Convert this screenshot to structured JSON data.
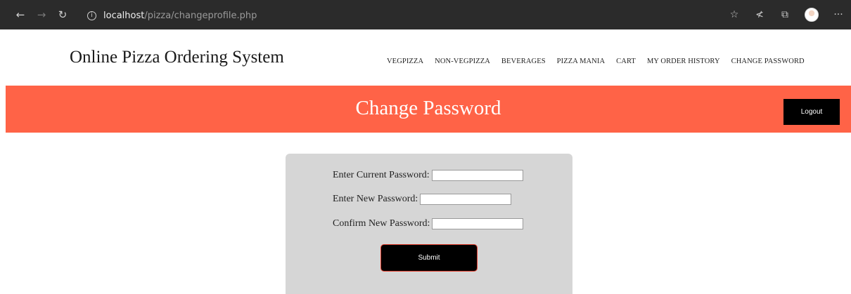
{
  "browser": {
    "url_host": "localhost",
    "url_path": "/pizza/changeprofile.php",
    "icons": [
      "back-arrow-icon",
      "forward-arrow-icon",
      "refresh-icon",
      "info-icon",
      "favorite-star-icon",
      "favorites-list-icon",
      "collections-icon",
      "profile-avatar",
      "more-icon"
    ]
  },
  "site": {
    "title": "Online Pizza Ordering System"
  },
  "menu": {
    "items": [
      {
        "label": "VEGPIZZA"
      },
      {
        "label": "NON-VEGPIZZA"
      },
      {
        "label": "BEVERAGES"
      },
      {
        "label": "PIZZA MANIA"
      },
      {
        "label": "CART"
      },
      {
        "label": "MY ORDER HISTORY"
      },
      {
        "label": "CHANGE PASSWORD"
      }
    ]
  },
  "banner": {
    "title": "Change Password",
    "logout_label": "Logout",
    "color": "#ff6347"
  },
  "form": {
    "current_label": "Enter Current Password:",
    "current_value": "",
    "new_label": "Enter New Password:",
    "new_value": "",
    "confirm_label": "Confirm New Password:",
    "confirm_value": "",
    "submit_label": "Submit"
  }
}
